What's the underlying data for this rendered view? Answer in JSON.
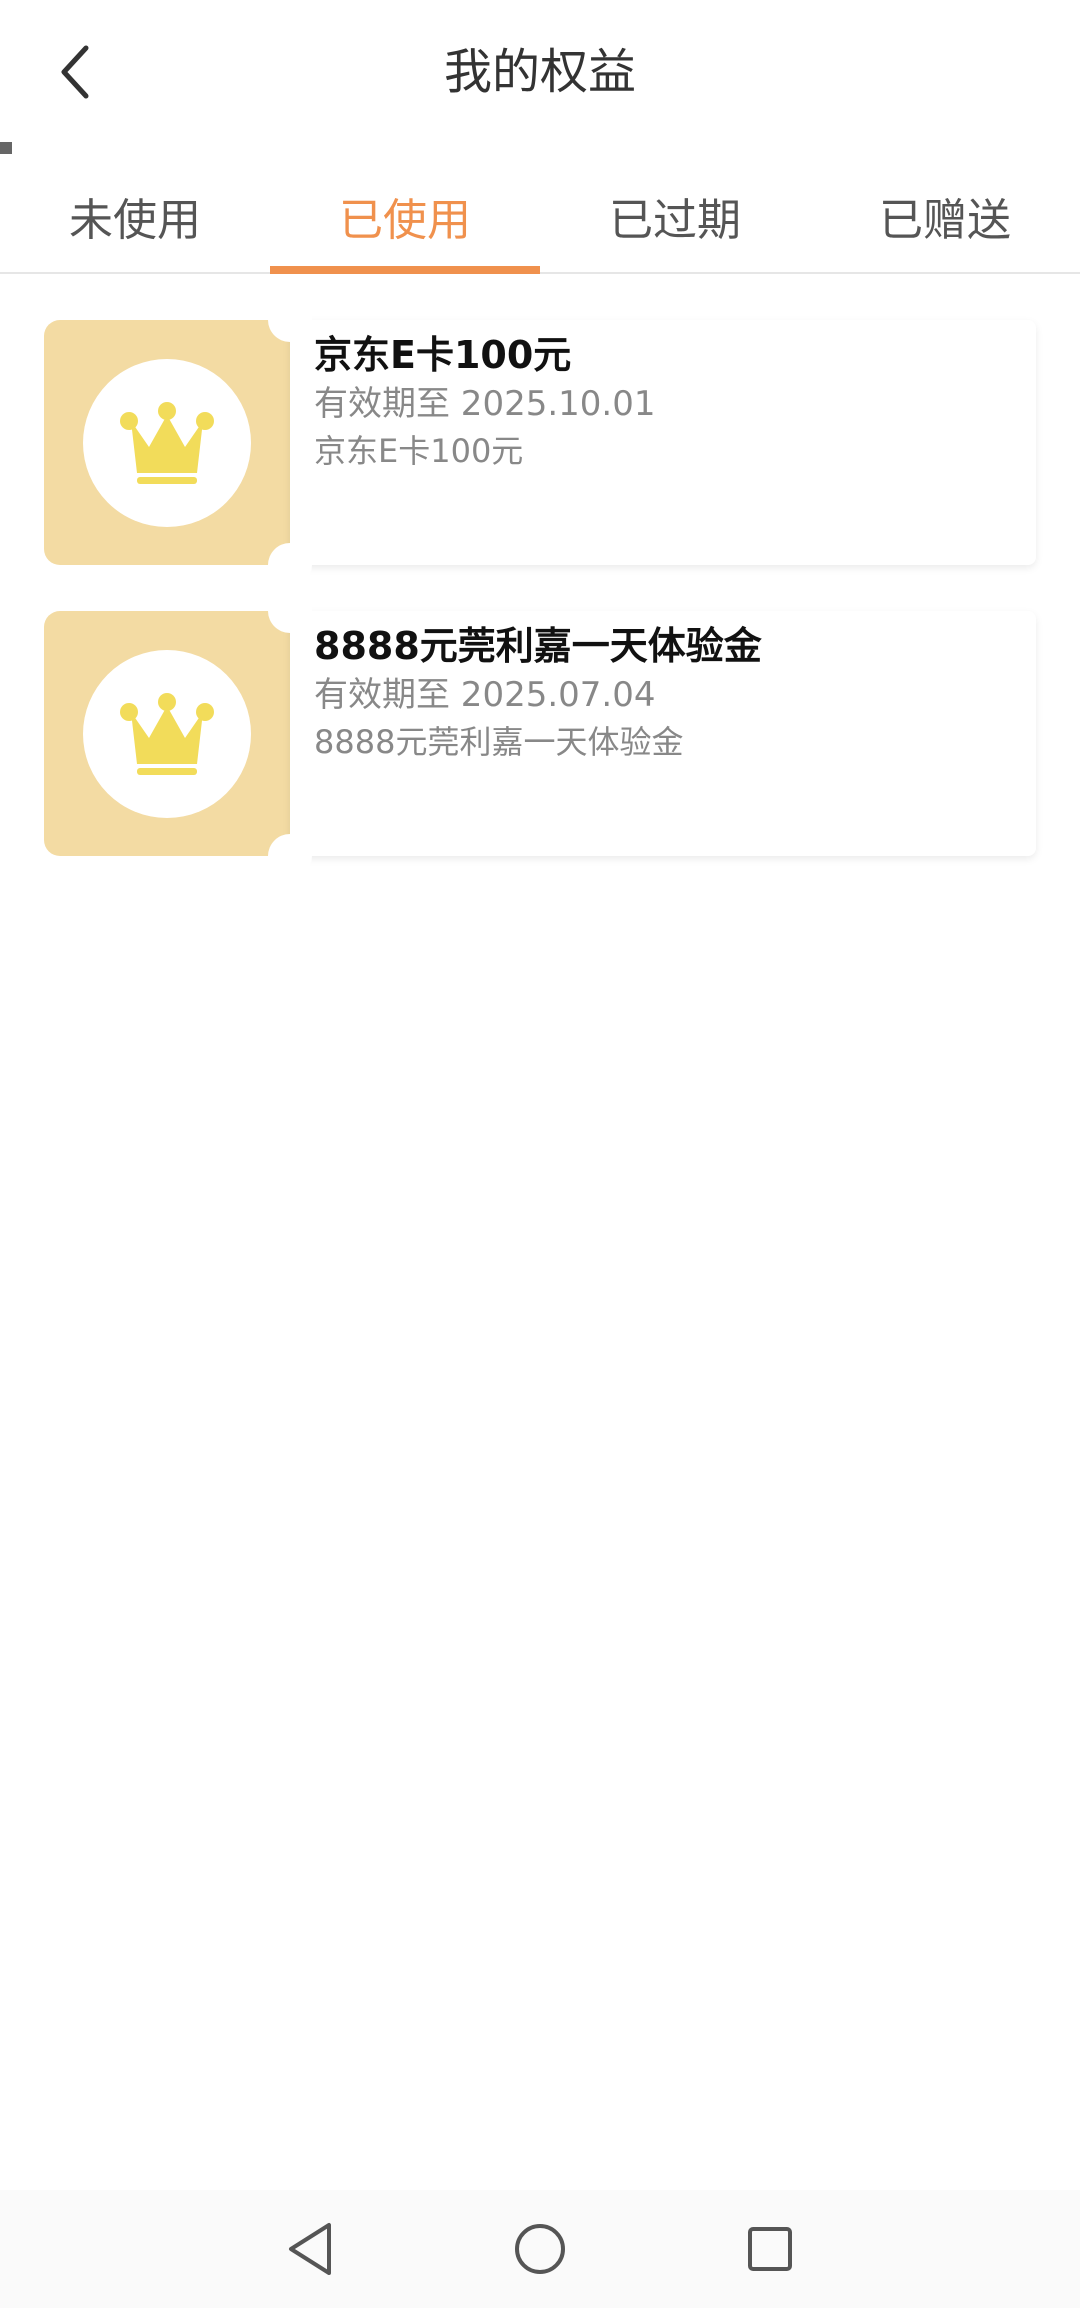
{
  "header": {
    "title": "我的权益"
  },
  "tabs": [
    {
      "label": "未使用",
      "active": false
    },
    {
      "label": "已使用",
      "active": true
    },
    {
      "label": "已过期",
      "active": false
    },
    {
      "label": "已赠送",
      "active": false
    }
  ],
  "cards": [
    {
      "title": "京东E卡100元",
      "expiry": "有效期至 2025.10.01",
      "desc": "京东E卡100元",
      "icon": "crown-icon"
    },
    {
      "title": "8888元莞利嘉一天体验金",
      "expiry": "有效期至 2025.07.04",
      "desc": "8888元莞利嘉一天体验金",
      "icon": "crown-icon"
    }
  ],
  "colors": {
    "accent": "#f0914d",
    "card_bg": "#f3dba3",
    "crown": "#f2dc5a"
  },
  "navbar": {
    "icons": [
      "back-triangle-icon",
      "home-circle-icon",
      "recents-square-icon"
    ]
  }
}
